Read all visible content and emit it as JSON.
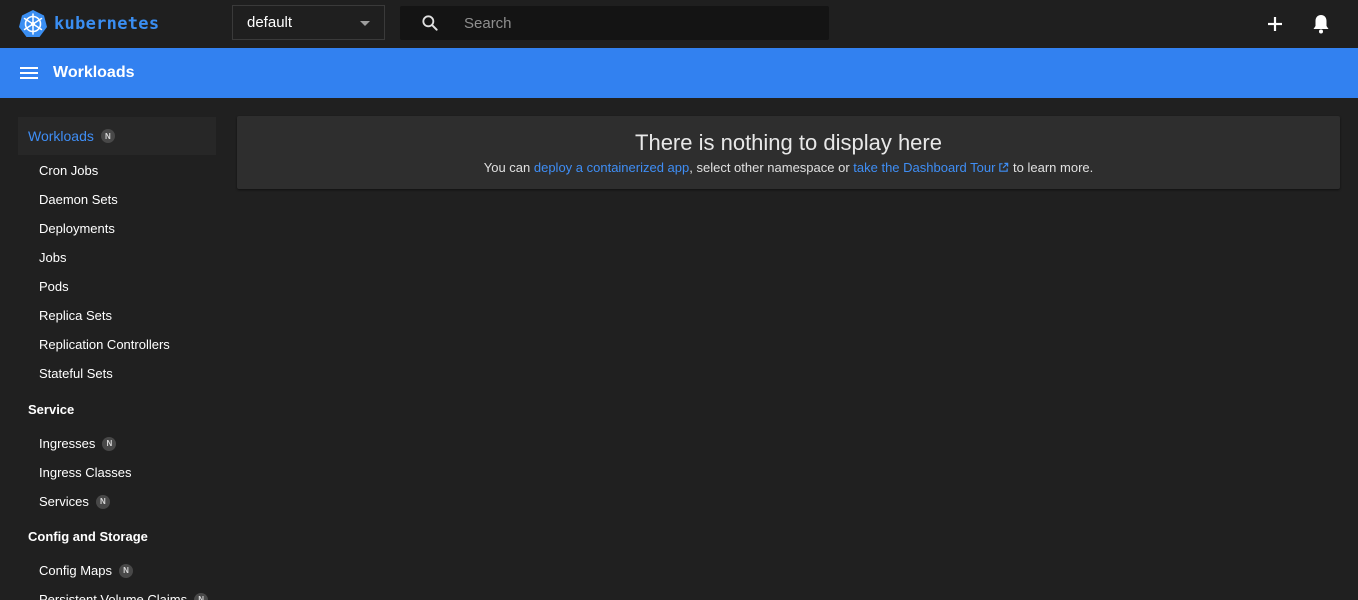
{
  "app": {
    "name": "kubernetes"
  },
  "namespace": {
    "selected": "default"
  },
  "search": {
    "placeholder": "Search"
  },
  "toolbar": {
    "title": "Workloads"
  },
  "sidebar": {
    "workloads": {
      "label": "Workloads",
      "badge": "N"
    },
    "workload_items": [
      {
        "label": "Cron Jobs"
      },
      {
        "label": "Daemon Sets"
      },
      {
        "label": "Deployments"
      },
      {
        "label": "Jobs"
      },
      {
        "label": "Pods"
      },
      {
        "label": "Replica Sets"
      },
      {
        "label": "Replication Controllers"
      },
      {
        "label": "Stateful Sets"
      }
    ],
    "service": {
      "label": "Service",
      "items": [
        {
          "label": "Ingresses",
          "badge": "N"
        },
        {
          "label": "Ingress Classes"
        },
        {
          "label": "Services",
          "badge": "N"
        }
      ]
    },
    "config": {
      "label": "Config and Storage",
      "items": [
        {
          "label": "Config Maps",
          "badge": "N"
        },
        {
          "label": "Persistent Volume Claims",
          "badge": "N"
        }
      ]
    }
  },
  "main": {
    "empty_title": "There is nothing to display here",
    "msg_prefix": "You can ",
    "link_deploy": "deploy a containerized app",
    "msg_middle": ", select other namespace or ",
    "link_tour": "take the Dashboard Tour",
    "msg_suffix": " to learn more."
  },
  "colors": {
    "accent": "#3281f0",
    "link": "#3f8ef5",
    "background": "#202020",
    "topbar": "#1f1f1f",
    "card": "#2e2e2e"
  },
  "icons": {
    "logo": "kubernetes-helm-icon",
    "search": "search-icon",
    "add": "plus-icon",
    "notifications": "bell-icon",
    "menu": "hamburger-menu-icon",
    "external": "external-link-icon",
    "dropdown": "caret-down-icon"
  }
}
